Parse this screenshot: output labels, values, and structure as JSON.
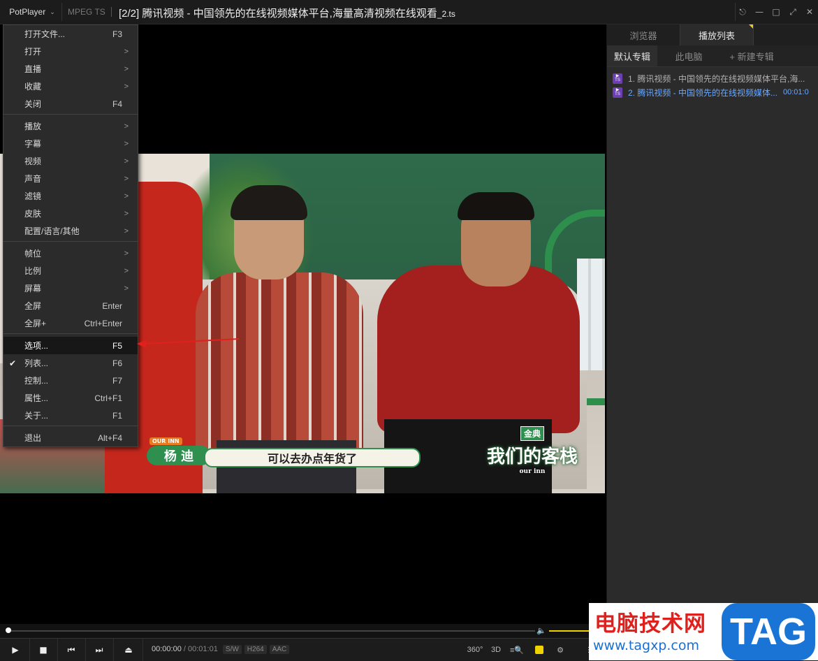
{
  "app": {
    "name": "PotPlayer",
    "format": "MPEG TS",
    "title_main": "[2/2] 腾讯视频 - 中国领先的在线视频媒体平台,海量高清视频在线观看",
    "title_ext": "_2.ts"
  },
  "window_buttons": [
    "pin-icon",
    "minimize-icon",
    "maximize-icon",
    "fullscreen-icon",
    "close-icon"
  ],
  "menu": {
    "items": [
      {
        "label": "打开文件...",
        "key": "F3",
        "arrow": ""
      },
      {
        "label": "打开",
        "key": "",
        "arrow": ">"
      },
      {
        "label": "直播",
        "key": "",
        "arrow": ">"
      },
      {
        "label": "收藏",
        "key": "",
        "arrow": ">"
      },
      {
        "label": "关闭",
        "key": "F4",
        "arrow": ""
      },
      {
        "label": "播放",
        "key": "",
        "arrow": ">"
      },
      {
        "label": "字幕",
        "key": "",
        "arrow": ">"
      },
      {
        "label": "视频",
        "key": "",
        "arrow": ">"
      },
      {
        "label": "声音",
        "key": "",
        "arrow": ">"
      },
      {
        "label": "滤镜",
        "key": "",
        "arrow": ">"
      },
      {
        "label": "皮肤",
        "key": "",
        "arrow": ">"
      },
      {
        "label": "配置/语言/其他",
        "key": "",
        "arrow": ">"
      },
      {
        "label": "帧位",
        "key": "",
        "arrow": ">"
      },
      {
        "label": "比例",
        "key": "",
        "arrow": ">"
      },
      {
        "label": "屏幕",
        "key": "",
        "arrow": ">"
      },
      {
        "label": "全屏",
        "key": "Enter",
        "arrow": ""
      },
      {
        "label": "全屏+",
        "key": "Ctrl+Enter",
        "arrow": ""
      },
      {
        "label": "选项...",
        "key": "F5",
        "arrow": ""
      },
      {
        "label": "列表...",
        "key": "F6",
        "arrow": ""
      },
      {
        "label": "控制...",
        "key": "F7",
        "arrow": ""
      },
      {
        "label": "属性...",
        "key": "Ctrl+F1",
        "arrow": ""
      },
      {
        "label": "关于...",
        "key": "F1",
        "arrow": ""
      },
      {
        "label": "退出",
        "key": "Alt+F4",
        "arrow": ""
      }
    ],
    "selected_label": "选项...",
    "checked_label": "列表..."
  },
  "video": {
    "name_badge_top": "OUR INN",
    "name_tag": "杨 迪",
    "subtitle": "可以去办点年货了",
    "show_logo_badge": "金典",
    "show_logo_text": "我们的客栈",
    "show_logo_tag": "our inn"
  },
  "panel": {
    "tabs": [
      {
        "label": "浏览器"
      },
      {
        "label": "播放列表"
      }
    ],
    "subtabs": [
      {
        "label": "默认专辑"
      },
      {
        "label": "此电脑"
      },
      {
        "label": "+ 新建专辑"
      }
    ],
    "items": [
      {
        "text": "1. 腾讯视频 - 中国领先的在线视频媒体平台,海...",
        "duration": "",
        "icon": "TS"
      },
      {
        "text": "2. 腾讯视频 - 中国领先的在线视频媒体...",
        "duration": "00:01:0",
        "icon": "TS"
      }
    ]
  },
  "playback": {
    "current": "00:00:00",
    "separator": "/",
    "total": "00:01:01",
    "chips": [
      "S/W",
      "H264",
      "AAC"
    ],
    "right_labels": {
      "vr": "360°",
      "three_d": "3D"
    },
    "progress": 0,
    "volume": 1
  },
  "watermark": {
    "cn": "电脑技术网",
    "url": "www.tagxp.com",
    "logo": "TAG"
  },
  "colors": {
    "accent_yellow": "#f0d200",
    "playlist_current": "#6aa8ff",
    "annotation_arrow": "#e0201c"
  }
}
